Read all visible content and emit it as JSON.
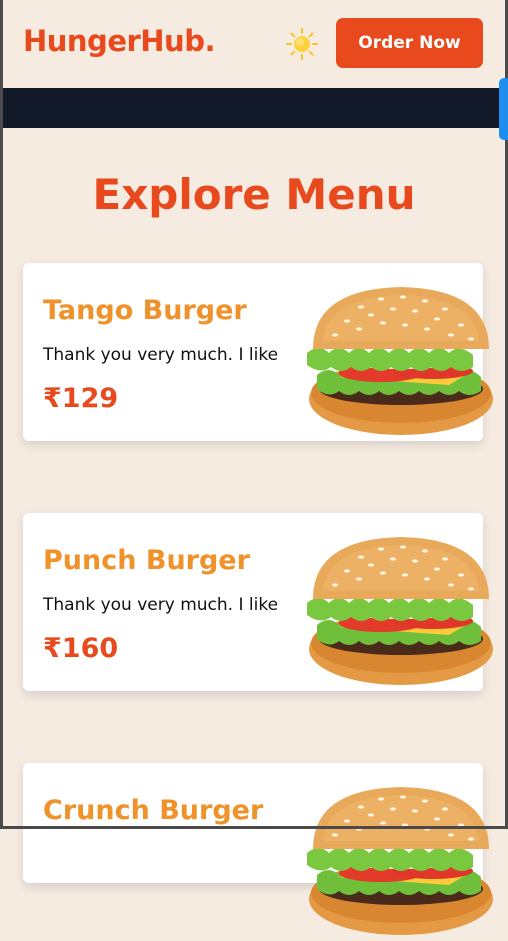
{
  "header": {
    "brand": "HungerHub.",
    "theme_icon": "sun-icon",
    "order_button": "Order Now"
  },
  "menu": {
    "title": "Explore Menu",
    "items": [
      {
        "name": "Tango Burger",
        "desc": "Thank you very much. I like",
        "price": "₹129",
        "image_icon": "burger-icon"
      },
      {
        "name": "Punch Burger",
        "desc": "Thank you very much. I like",
        "price": "₹160",
        "image_icon": "burger-icon"
      },
      {
        "name": "Crunch Burger",
        "desc": "",
        "price": "",
        "image_icon": "burger-icon"
      }
    ]
  },
  "colors": {
    "accent": "#e8491d",
    "item_name": "#f0922a",
    "page_bg": "#f5ebe1",
    "dark_bar": "#111827",
    "scrollbar": "#1d8ef0"
  }
}
